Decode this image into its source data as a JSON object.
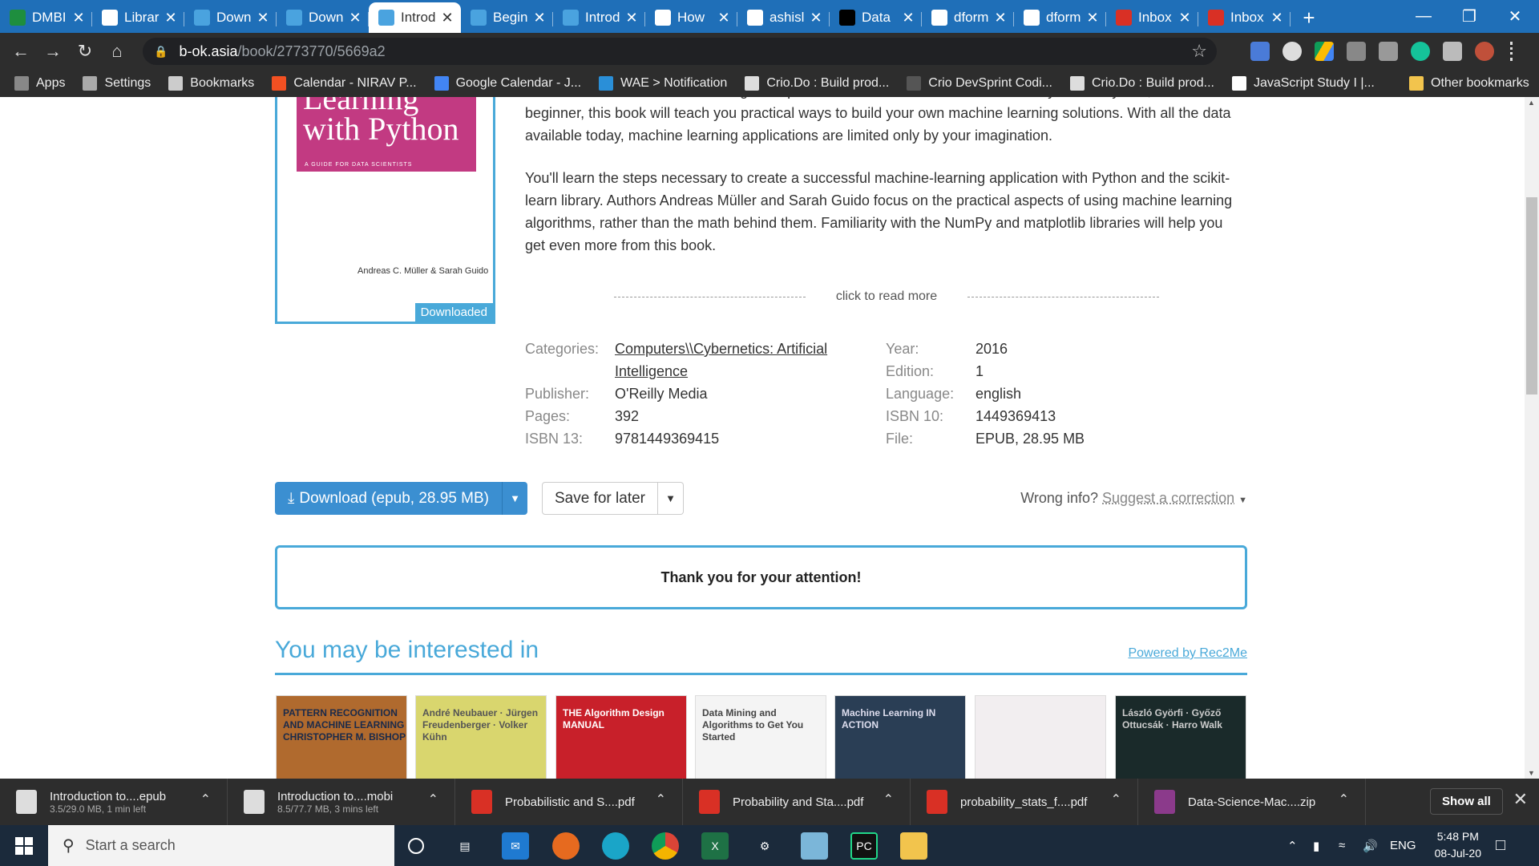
{
  "browser": {
    "tabs": [
      {
        "title": "DMBI",
        "icon": "sheets-icon",
        "color": "#1e8e3e"
      },
      {
        "title": "Librar",
        "icon": "doc-icon",
        "color": "#ffffff"
      },
      {
        "title": "Down",
        "icon": "globe-icon",
        "color": "#4aa3df"
      },
      {
        "title": "Down",
        "icon": "globe-icon",
        "color": "#4aa3df"
      },
      {
        "title": "Introd",
        "icon": "globe-icon",
        "color": "#4aa3df",
        "active": true
      },
      {
        "title": "Begin",
        "icon": "globe-icon",
        "color": "#4aa3df"
      },
      {
        "title": "Introd",
        "icon": "globe-icon",
        "color": "#4aa3df"
      },
      {
        "title": "How",
        "icon": "linkedin-icon",
        "color": "#ffffff"
      },
      {
        "title": "ashisl",
        "icon": "github-icon",
        "color": "#ffffff"
      },
      {
        "title": "Data",
        "icon": "medium-icon",
        "color": "#000000"
      },
      {
        "title": "dform",
        "icon": "github-icon",
        "color": "#ffffff"
      },
      {
        "title": "dform",
        "icon": "github-icon",
        "color": "#ffffff"
      },
      {
        "title": "Inbox",
        "icon": "gmail-icon",
        "color": "#d93025"
      },
      {
        "title": "Inbox",
        "icon": "gmail-icon",
        "color": "#d93025"
      }
    ],
    "url_host": "b-ok.asia",
    "url_path": "/book/2773770/5669a2",
    "bookmarks": [
      {
        "label": "Apps",
        "icon": "apps-grid-icon"
      },
      {
        "label": "Settings",
        "icon": "gear-icon"
      },
      {
        "label": "Bookmarks",
        "icon": "star-icon"
      },
      {
        "label": "Calendar - NIRAV P...",
        "icon": "calendar-icon"
      },
      {
        "label": "Google Calendar - J...",
        "icon": "google-calendar-icon"
      },
      {
        "label": "WAE > Notification",
        "icon": "wae-icon"
      },
      {
        "label": "Crio.Do : Build prod...",
        "icon": "crio-icon"
      },
      {
        "label": "Crio DevSprint Codi...",
        "icon": "crio-icon"
      },
      {
        "label": "Crio.Do : Build prod...",
        "icon": "crio-icon"
      },
      {
        "label": "JavaScript Study I |...",
        "icon": "p-icon"
      }
    ],
    "other_bookmarks": "Other bookmarks"
  },
  "book": {
    "cover_title_lines": [
      "Learning",
      "with Python"
    ],
    "cover_subtitle": "A GUIDE FOR DATA SCIENTISTS",
    "cover_authors": "Andreas C. Müller & Sarah Guido",
    "downloaded_badge": "Downloaded",
    "desc_p1": "but this field is not exclusive to large companies with extensive research teams. If you use Python, even as a beginner, this book will teach you practical ways to build your own machine learning solutions. With all the data available today, machine learning applications are limited only by your imagination.",
    "desc_p2": "You'll learn the steps necessary to create a successful machine-learning application with Python and the scikit-learn library. Authors Andreas Müller and Sarah Guido focus on the practical aspects of using machine learning algorithms, rather than the math behind them. Familiarity with the NumPy and matplotlib libraries will help you get even more from this book.",
    "read_more": "click to read more",
    "props_left": [
      {
        "k": "Categories:",
        "v": "Computers\\\\Cybernetics: Artificial Intelligence",
        "link": true
      },
      {
        "k": "Publisher:",
        "v": "O'Reilly Media"
      },
      {
        "k": "Pages:",
        "v": "392"
      },
      {
        "k": "ISBN 13:",
        "v": "9781449369415"
      }
    ],
    "props_right": [
      {
        "k": "Year:",
        "v": "2016"
      },
      {
        "k": "Edition:",
        "v": "1"
      },
      {
        "k": "Language:",
        "v": "english"
      },
      {
        "k": "ISBN 10:",
        "v": "1449369413"
      },
      {
        "k": "File:",
        "v": "EPUB, 28.95 MB"
      }
    ],
    "download_label": "Download (epub, 28.95 MB)",
    "save_label": "Save for later",
    "wrong_info": "Wrong info?",
    "suggest": "Suggest a correction",
    "thanks": "Thank you for your attention!",
    "interest_title": "You may be interested in",
    "powered": "Powered by Rec2Me",
    "recs": [
      {
        "text": "PATTERN RECOGNITION AND MACHINE LEARNING CHRISTOPHER M. BISHOP",
        "bg": "#b06a2e",
        "fg": "#1a2a4a"
      },
      {
        "text": "André Neubauer · Jürgen Freudenberger · Volker Kühn",
        "bg": "#d9d66e",
        "fg": "#555"
      },
      {
        "text": "THE Algorithm Design MANUAL",
        "bg": "#c8202a",
        "fg": "#fff"
      },
      {
        "text": "Data Mining and Algorithms to Get You Started",
        "bg": "#f4f4f4",
        "fg": "#444"
      },
      {
        "text": "Machine Learning IN ACTION",
        "bg": "#2a3e55",
        "fg": "#dde"
      },
      {
        "text": "",
        "bg": "#f2eef0",
        "fg": "#333"
      },
      {
        "text": "László Györfi · Győző Ottucsák · Harro Walk",
        "bg": "#1a2a2a",
        "fg": "#ccc"
      }
    ]
  },
  "downloads": [
    {
      "name": "Introduction to....epub",
      "status": "3.5/29.0 MB, 1 min left",
      "icon": "file-progress-icon"
    },
    {
      "name": "Introduction to....mobi",
      "status": "8.5/77.7 MB, 3 mins left",
      "icon": "file-progress-icon"
    },
    {
      "name": "Probabilistic and S....pdf",
      "status": "",
      "icon": "pdf-icon"
    },
    {
      "name": "Probability and Sta....pdf",
      "status": "",
      "icon": "pdf-icon"
    },
    {
      "name": "probability_stats_f....pdf",
      "status": "",
      "icon": "pdf-icon"
    },
    {
      "name": "Data-Science-Mac....zip",
      "status": "",
      "icon": "zip-icon"
    }
  ],
  "show_all": "Show all",
  "taskbar": {
    "search_placeholder": "Start a search",
    "lang": "ENG",
    "time": "5:48 PM",
    "date": "08-Jul-20"
  }
}
